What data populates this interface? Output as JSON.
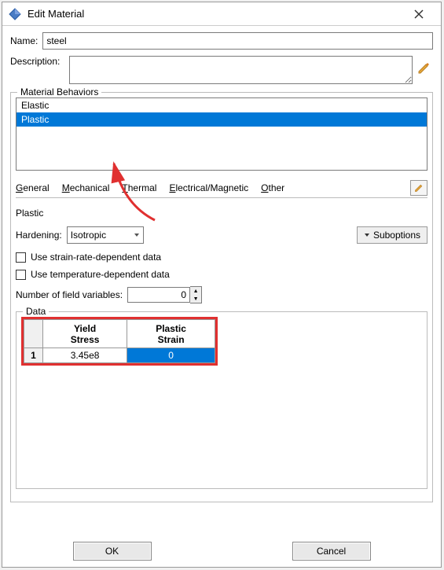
{
  "window": {
    "title": "Edit Material"
  },
  "form": {
    "name_label": "Name:",
    "name_value": "steel",
    "description_label": "Description:",
    "description_value": ""
  },
  "behaviors": {
    "legend": "Material Behaviors",
    "items": [
      "Elastic",
      "Plastic"
    ],
    "selected_index": 1
  },
  "menus": {
    "general": "General",
    "mechanical": "Mechanical",
    "thermal": "Thermal",
    "electrical": "Electrical/Magnetic",
    "other": "Other"
  },
  "plastic": {
    "title": "Plastic",
    "hardening_label": "Hardening:",
    "hardening_value": "Isotropic",
    "suboptions_label": "Suboptions",
    "strain_rate_label": "Use strain-rate-dependent data",
    "temp_label": "Use temperature-dependent data",
    "field_vars_label": "Number of field variables:",
    "field_vars_value": "0"
  },
  "data": {
    "legend": "Data",
    "columns": [
      "Yield\nStress",
      "Plastic\nStrain"
    ],
    "rows": [
      {
        "index": "1",
        "yield_stress": "3.45e8",
        "plastic_strain": "0"
      }
    ]
  },
  "buttons": {
    "ok": "OK",
    "cancel": "Cancel"
  }
}
